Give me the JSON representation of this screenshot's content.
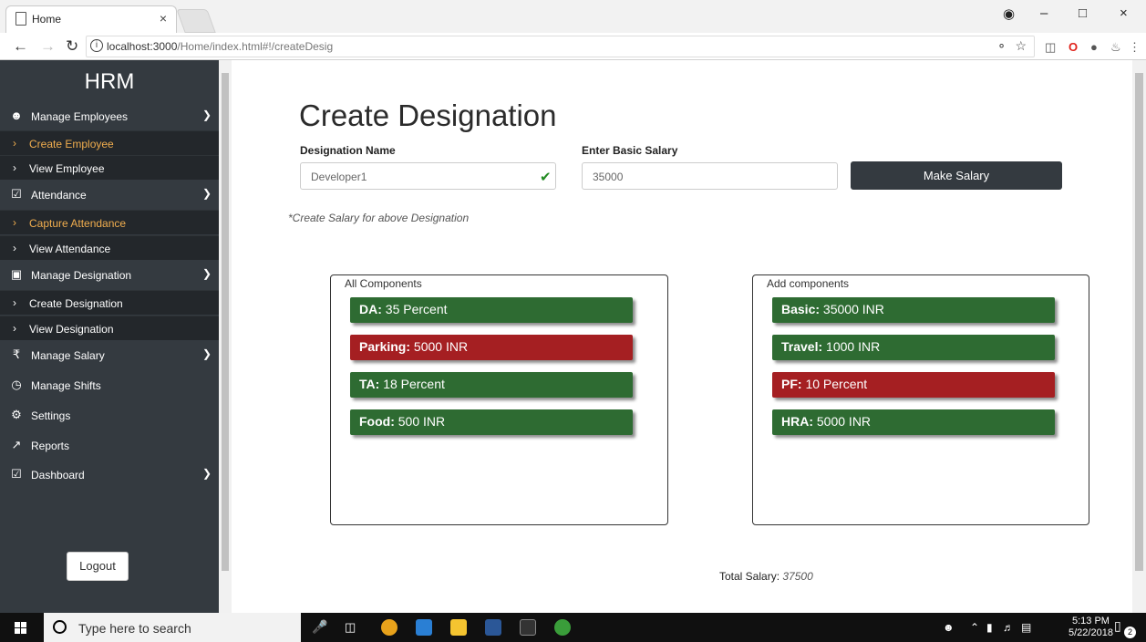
{
  "browser": {
    "tab_title": "Home",
    "tab_close": "×",
    "url_host": "localhost:3000",
    "url_path": "/Home/index.html#!/createDesig",
    "window_controls": [
      "–",
      "□",
      "×"
    ]
  },
  "sidebar": {
    "brand": "HRM",
    "items": [
      {
        "label": "Manage Employees",
        "icon": "user-circle-icon",
        "chevron": true
      },
      {
        "label": "Create Employee",
        "active": true
      },
      {
        "label": "View Employee"
      },
      {
        "label": "Attendance",
        "icon": "calendar-check-icon",
        "chevron": true
      },
      {
        "label": "Capture Attendance",
        "active": true
      },
      {
        "label": "View Attendance"
      },
      {
        "label": "Manage Designation",
        "icon": "id-badge-icon",
        "chevron": true
      },
      {
        "label": "Create Designation"
      },
      {
        "label": "View Designation"
      },
      {
        "label": "Manage Salary",
        "icon": "rupee-icon",
        "chevron": true
      },
      {
        "label": "Manage Shifts",
        "icon": "clock-icon"
      },
      {
        "label": "Settings",
        "icon": "gear-icon"
      },
      {
        "label": "Reports",
        "icon": "chart-icon"
      },
      {
        "label": "Dashboard",
        "icon": "calendar-check-icon",
        "chevron": true
      }
    ],
    "logout_label": "Logout"
  },
  "main": {
    "title": "Create Designation",
    "designation_label": "Designation Name",
    "designation_value": "Developer1",
    "salary_label": "Enter Basic Salary",
    "salary_value": "35000",
    "make_salary_label": "Make Salary",
    "hint": "*Create Salary for above Designation",
    "all_components_title": "All Components",
    "all_components": [
      {
        "name": "DA:",
        "value": "35 Percent",
        "color": "#2e6b32"
      },
      {
        "name": "Parking:",
        "value": "5000 INR",
        "color": "#a51f22"
      },
      {
        "name": "TA:",
        "value": "18 Percent",
        "color": "#2e6b32"
      },
      {
        "name": "Food:",
        "value": "500 INR",
        "color": "#2e6b32"
      }
    ],
    "add_components_title": "Add components",
    "add_components": [
      {
        "name": "Basic:",
        "value": "35000 INR",
        "color": "#2e6b32"
      },
      {
        "name": "Travel:",
        "value": "1000 INR",
        "color": "#2e6b32"
      },
      {
        "name": "PF:",
        "value": "10 Percent",
        "color": "#a51f22"
      },
      {
        "name": "HRA:",
        "value": "5000 INR",
        "color": "#2e6b32"
      }
    ],
    "total_label": "Total Salary:",
    "total_value": "37500"
  },
  "taskbar": {
    "search_placeholder": "Type here to search",
    "time": "5:13 PM",
    "date": "5/22/2018",
    "notification_count": "2"
  }
}
